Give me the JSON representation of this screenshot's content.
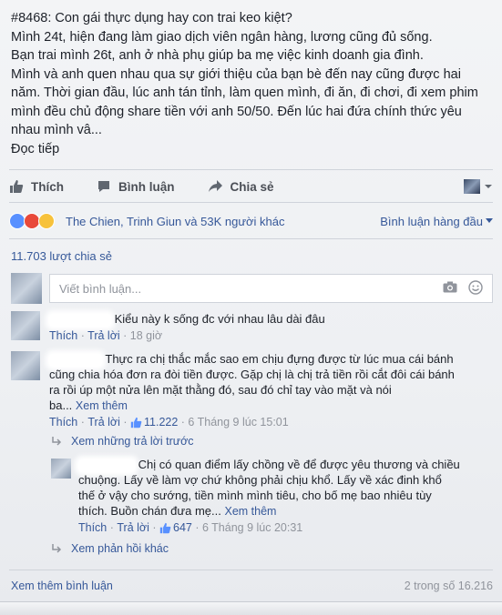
{
  "post": {
    "title": "#8468: Con gái thực dụng hay con trai keo kiệt?",
    "lines": [
      "Mình 24t, hiện đang làm giao dịch viên ngân hàng, lương cũng đủ sống.",
      "Bạn trai mình 26t, anh ở nhà phụ giúp ba mẹ việc kinh doanh gia đình.",
      "Mình và anh quen nhau qua sự giới thiệu của bạn bè đến nay cũng được hai năm. Thời gian đầu, lúc anh tán tỉnh, làm quen mình, đi ăn, đi chơi, đi xem phim mình đều chủ động share tiền với anh 50/50. Đến lúc hai đứa chính thức yêu nhau mình vâ..."
    ],
    "see_more": "Đọc tiếp"
  },
  "actions": {
    "like": "Thích",
    "comment": "Bình luận",
    "share": "Chia sẻ"
  },
  "reactions": {
    "names": "The Chien, Trinh Giun và 53K người khác",
    "sort": "Bình luận hàng đầu"
  },
  "shares": "11.703 lượt chia sẻ",
  "comment_box": {
    "placeholder": "Viết bình luận..."
  },
  "comments": [
    {
      "text": "Kiểu này k sống đc với nhau lâu dài đâu",
      "like": "Thích",
      "reply": "Trả lời",
      "time": "18 giờ"
    },
    {
      "line1": "Thực ra chị thắc mắc sao em chịu đựng được từ lúc mua cái bánh",
      "line2": "cũng chia hóa đơn ra đòi tiền được. Gặp chị là chị trả tiền rồi cắt đôi cái bánh",
      "line3": "ra rồi úp một nửa lên mặt thằng đó, sau đó chỉ tay vào mặt và nói",
      "line4_prefix": "ba...",
      "see_more": "Xem thêm",
      "like": "Thích",
      "reply": "Trả lời",
      "likes": "11.222",
      "time": "6 Tháng 9 lúc 15:01"
    }
  ],
  "previous_replies": "Xem những trả lời trước",
  "reply": {
    "line1": "Chị có quan điểm lấy chồng về để được yêu thương và chiều",
    "line2": "chuộng. Lấy về làm vợ chứ không phải chịu khổ. Lấy về xác đinh khổ",
    "line3": "thế ở vậy cho sướng, tiền mình mình tiêu, cho bố mẹ bao nhiêu tùy",
    "line4_prefix": "thích. Buồn chán đưa mẹ...",
    "see_more": "Xem thêm",
    "like": "Thích",
    "reply_label": "Trả lời",
    "likes": "647",
    "time": "6 Tháng 9 lúc 20:31"
  },
  "more_replies": "Xem phản hồi khác",
  "footer": {
    "more_comments": "Xem thêm bình luận",
    "count": "2 trong số 16.216"
  },
  "colors": {
    "link": "#365899",
    "muted": "#90949c",
    "like_blue": "#5890ff"
  }
}
